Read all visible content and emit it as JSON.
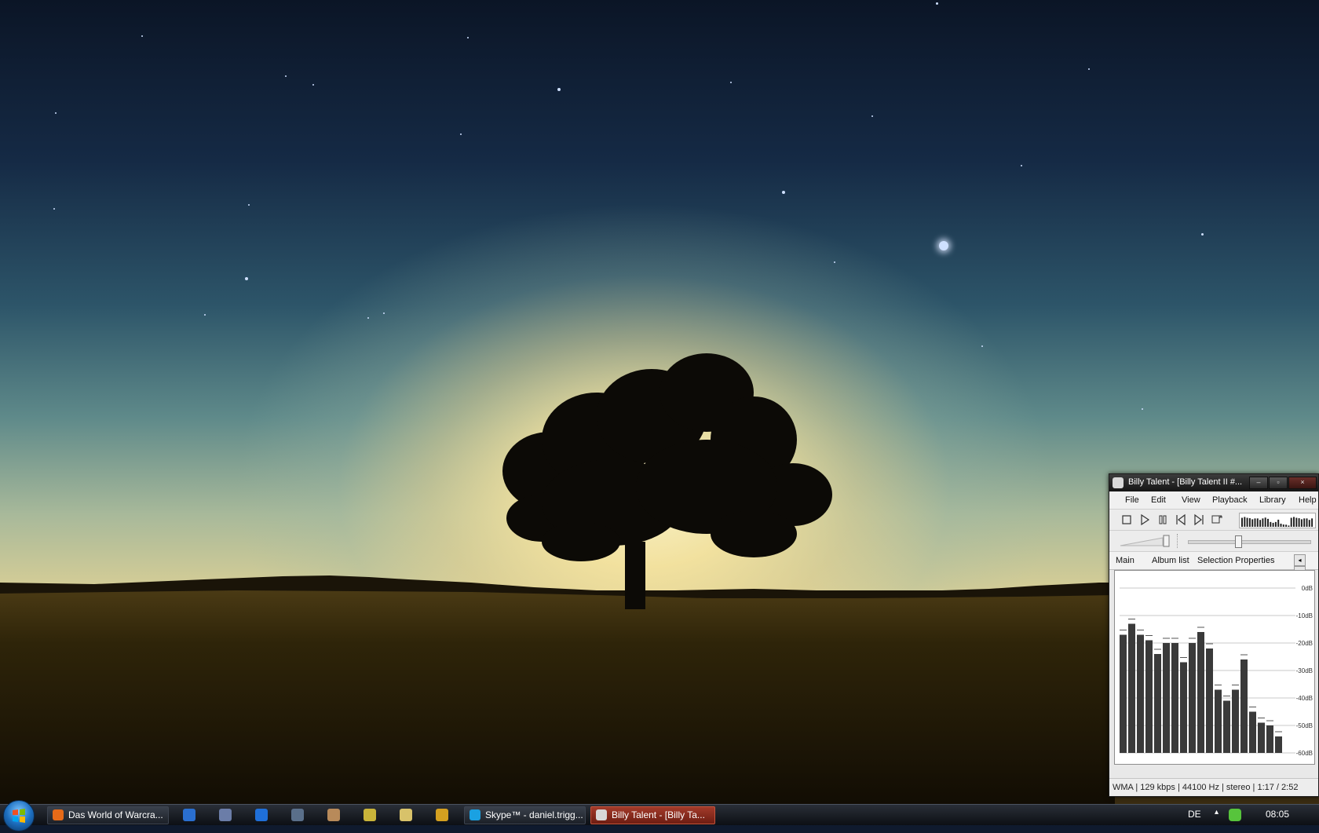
{
  "window": {
    "title": "Billy Talent - [Billy Talent II #...",
    "minimize": "–",
    "maximize": "▫",
    "close": "×"
  },
  "menu": [
    "File",
    "Edit",
    "View",
    "Playback",
    "Library",
    "Help"
  ],
  "toolbar": {
    "buttons": [
      "stop",
      "play",
      "pause",
      "previous",
      "next",
      "random"
    ]
  },
  "tabs": [
    "Main",
    "Album list",
    "Selection Properties"
  ],
  "spectrum": {
    "db_labels": [
      "0dB",
      "-10dB",
      "-20dB",
      "-30dB",
      "-40dB",
      "-50dB",
      "-60dB"
    ],
    "levels_db": [
      -17,
      -13,
      -17,
      -19,
      -24,
      -20,
      -20,
      -27,
      -20,
      -16,
      -22,
      -37,
      -41,
      -37,
      -26,
      -45,
      -49,
      -50,
      -54
    ]
  },
  "status": {
    "text": "WMA | 129 kbps | 44100 Hz | stereo | 1:17 / 2:52"
  },
  "taskbar": {
    "tasks": [
      {
        "label": "Das World of Warcra...",
        "color": "#e66a18",
        "active": false
      },
      {
        "label": "Skype™ - daniel.trigg...",
        "color": "#1aa1e2",
        "active": false
      },
      {
        "label": "Billy Talent - [Billy Ta...",
        "color": "#d8d8d8",
        "active": true
      }
    ],
    "quicklaunch_colors": [
      "#2a6fd0",
      "#6b7da8",
      "#1f6fd8",
      "#5a6f8a",
      "#b88a5a",
      "#c9b43a",
      "#d8c26a",
      "#d4a020"
    ],
    "language": "DE",
    "tray_arrow": "▴",
    "clock": "08:05"
  }
}
